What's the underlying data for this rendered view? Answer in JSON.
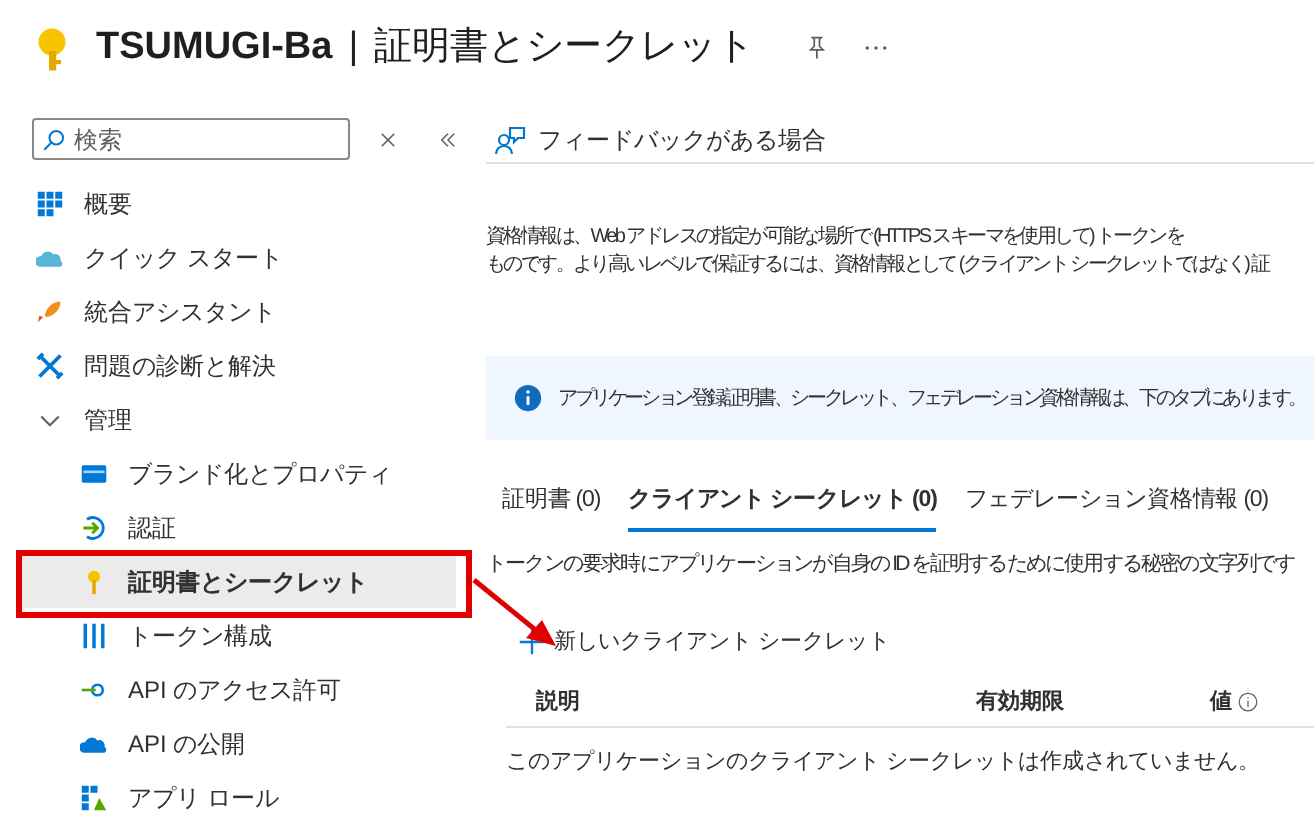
{
  "header": {
    "app_name": "TSUMUGI-Ba",
    "separator": "|",
    "page_title": "証明書とシークレット"
  },
  "sidebar": {
    "search": {
      "placeholder": "検索"
    },
    "items": [
      {
        "label": "概要",
        "selected": false
      },
      {
        "label": "クイック スタート",
        "selected": false
      },
      {
        "label": "統合アシスタント",
        "selected": false
      },
      {
        "label": "問題の診断と解決",
        "selected": false
      },
      {
        "label": "管理",
        "expanded": true,
        "selected": false,
        "children": [
          {
            "label": "ブランド化とプロパティ",
            "selected": false
          },
          {
            "label": "認証",
            "selected": false
          },
          {
            "label": "証明書とシークレット",
            "selected": true
          },
          {
            "label": "トークン構成",
            "selected": false
          },
          {
            "label": "API のアクセス許可",
            "selected": false
          },
          {
            "label": "API の公開",
            "selected": false
          },
          {
            "label": "アプリ ロール",
            "selected": false
          }
        ]
      }
    ]
  },
  "toolbar": {
    "feedback": "フィードバックがある場合"
  },
  "intro": [
    "資格情報は、Web アドレスの指定が可能な場所で (HTTPS スキーマを使用して) トークンを",
    "ものです。より高いレベルで保証するには、資格情報として (クライアント シークレットではなく) 証"
  ],
  "info_banner": "アプリケーション登録証明書、シークレット、フェデレーション資格情報は、下のタブにあります。",
  "tabs": [
    {
      "label": "証明書 (0)",
      "selected": false
    },
    {
      "label": "クライアント シークレット (0)",
      "selected": true
    },
    {
      "label": "フェデレーション資格情報 (0)",
      "selected": false
    }
  ],
  "tab_description": "トークンの要求時にアプリケーションが自身の ID を証明するために使用する秘密の文字列です",
  "new_button": "新しいクライアント シークレット",
  "table": {
    "columns": [
      "説明",
      "有効期限",
      "値"
    ],
    "empty_message": "このアプリケーションのクライアント シークレットは作成されていません。"
  }
}
